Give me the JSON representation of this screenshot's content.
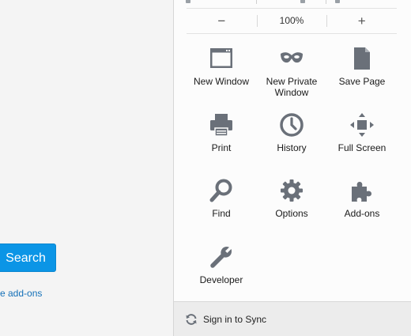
{
  "page": {
    "search_button_label": "Search",
    "addons_link_text": "e add-ons"
  },
  "menu": {
    "zoom": {
      "minus": "−",
      "value": "100%",
      "plus": "+"
    },
    "items": [
      {
        "label": "New Window",
        "icon": "window-icon"
      },
      {
        "label": "New Private\nWindow",
        "icon": "private-mask-icon"
      },
      {
        "label": "Save Page",
        "icon": "document-icon"
      },
      {
        "label": "Print",
        "icon": "printer-icon"
      },
      {
        "label": "History",
        "icon": "clock-icon"
      },
      {
        "label": "Full Screen",
        "icon": "fullscreen-arrows-icon"
      },
      {
        "label": "Find",
        "icon": "magnifier-icon"
      },
      {
        "label": "Options",
        "icon": "gear-icon"
      },
      {
        "label": "Add-ons",
        "icon": "puzzle-icon"
      },
      {
        "label": "Developer",
        "icon": "wrench-icon"
      }
    ],
    "sync_label": "Sign in to Sync"
  },
  "colors": {
    "accent": "#0b95e6",
    "link": "#1470b8",
    "icon": "#6a7079"
  }
}
